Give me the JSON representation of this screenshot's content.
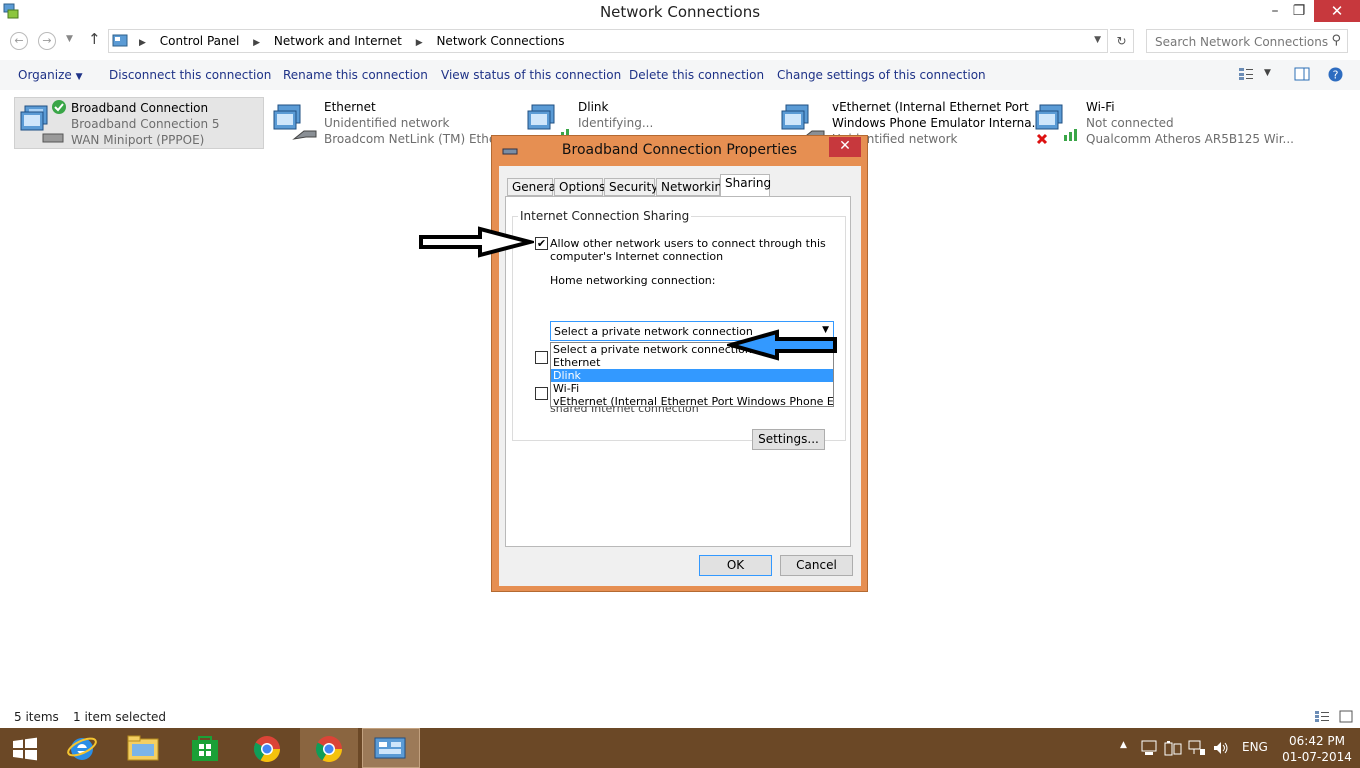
{
  "window": {
    "title": "Network Connections"
  },
  "address": {
    "crumbs": [
      "Control Panel",
      "Network and Internet",
      "Network Connections"
    ],
    "search_placeholder": "Search Network Connections"
  },
  "commands": {
    "organize": "Organize",
    "disconnect": "Disconnect this connection",
    "rename": "Rename this connection",
    "view_status": "View status of this connection",
    "delete": "Delete this connection",
    "change_settings": "Change settings of this connection"
  },
  "connections": [
    {
      "name": "Broadband Connection",
      "status": "Broadband Connection  5",
      "device": "WAN Miniport (PPPOE)"
    },
    {
      "name": "Ethernet",
      "status": "Unidentified network",
      "device": "Broadcom NetLink (TM) Ethern"
    },
    {
      "name": "Dlink",
      "status": "Identifying...",
      "device": ""
    },
    {
      "name": "vEthernet (Internal Ethernet Port",
      "status": "Windows Phone Emulator Interna...",
      "device": "Unidentified network"
    },
    {
      "name": "Wi-Fi",
      "status": "Not connected",
      "device": "Qualcomm Atheros AR5B125 Wir..."
    }
  ],
  "statusbar": {
    "items": "5 items",
    "selected": "1 item selected"
  },
  "dialog": {
    "title": "Broadband Connection Properties",
    "tabs": [
      "General",
      "Options",
      "Security",
      "Networking",
      "Sharing"
    ],
    "active_tab": "Sharing",
    "group_title": "Internet Connection Sharing",
    "allow_label_1": "Allow other network users to connect through this",
    "allow_label_2": "computer's Internet connection",
    "allow_checked": true,
    "home_label": "Home networking connection:",
    "select_value": "Select a private network connection",
    "options": [
      "Select a private network connection",
      "Ethernet",
      "Dlink",
      "Wi-Fi",
      "vEthernet (Internal Ethernet Port Windows Phone Emulator"
    ],
    "highlighted_option": "Dlink",
    "hidden_text": "shared Internet connection",
    "settings_button": "Settings...",
    "ok_button": "OK",
    "cancel_button": "Cancel"
  },
  "tray": {
    "language": "ENG",
    "time": "06:42 PM",
    "date": "01-07-2014"
  },
  "colors": {
    "dialog_frame": "#e68f52",
    "close_red": "#c7383d",
    "highlight_blue": "#3399ff",
    "taskbar": "#6b4826",
    "command_text": "#1e3287"
  }
}
